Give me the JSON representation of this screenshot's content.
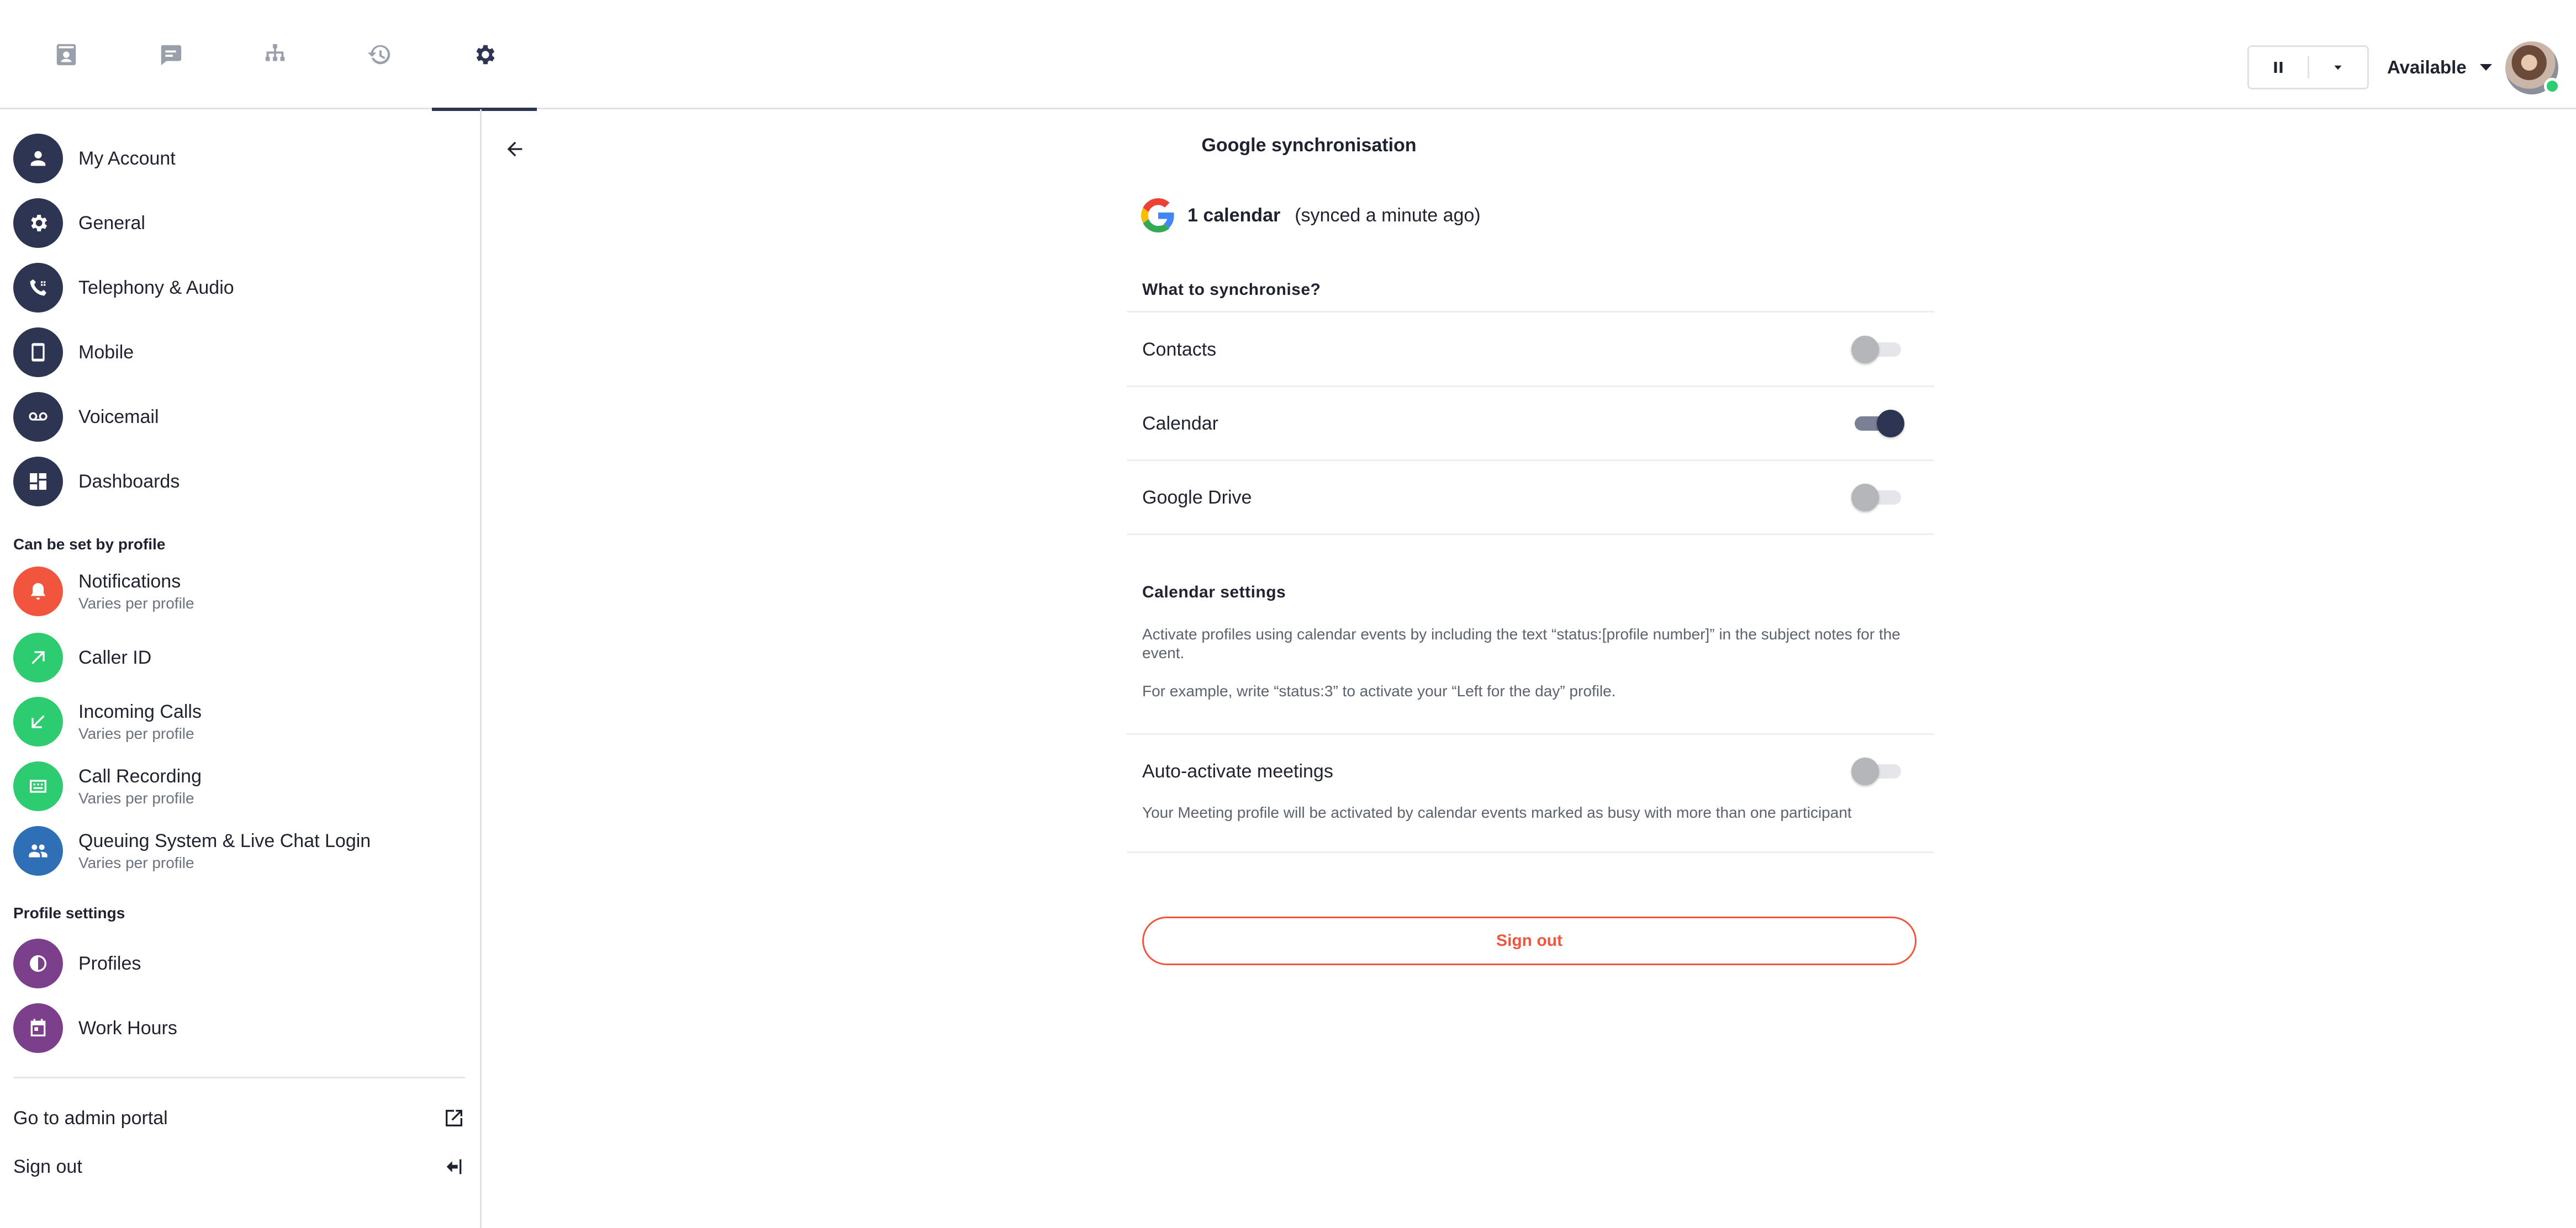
{
  "colors": {
    "navy": "#2d3552",
    "orange": "#f2553d",
    "green": "#2ecc71",
    "blue": "#2f6fb5",
    "purple": "#7b3f8c",
    "grey_icon": "#9aa0ab"
  },
  "topbar": {
    "tabs": [
      {
        "icon": "contacts-icon"
      },
      {
        "icon": "chat-icon"
      },
      {
        "icon": "org-chart-icon"
      },
      {
        "icon": "history-icon"
      },
      {
        "icon": "gear-icon",
        "active": true
      }
    ],
    "status_label": "Available"
  },
  "sidebar": {
    "items": [
      {
        "label": "My Account",
        "icon": "user-icon"
      },
      {
        "label": "General",
        "icon": "gear-icon"
      },
      {
        "label": "Telephony & Audio",
        "icon": "phone-icon"
      },
      {
        "label": "Mobile",
        "icon": "mobile-icon"
      },
      {
        "label": "Voicemail",
        "icon": "voicemail-icon"
      },
      {
        "label": "Dashboards",
        "icon": "dashboard-icon"
      }
    ],
    "section_profile": "Can be set by profile",
    "profile_items": [
      {
        "label": "Notifications",
        "sub": "Varies per profile",
        "icon": "bell-icon"
      },
      {
        "label": "Caller ID",
        "icon": "arrow-up-right-icon"
      },
      {
        "label": "Incoming Calls",
        "sub": "Varies per profile",
        "icon": "arrow-down-left-icon"
      },
      {
        "label": "Call Recording",
        "sub": "Varies per profile",
        "icon": "recording-icon"
      },
      {
        "label": "Queuing System & Live Chat Login",
        "sub": "Varies per profile",
        "icon": "group-icon"
      }
    ],
    "section_settings": "Profile settings",
    "settings_items": [
      {
        "label": "Profiles",
        "icon": "half-circle-icon"
      },
      {
        "label": "Work Hours",
        "icon": "calendar-icon"
      }
    ],
    "footer": {
      "admin_portal": "Go to admin portal",
      "sign_out": "Sign out"
    }
  },
  "main": {
    "title": "Google synchronisation",
    "sync_count": "1 calendar",
    "sync_status": "(synced a minute ago)",
    "what_heading": "What to synchronise?",
    "toggles": [
      {
        "label": "Contacts",
        "on": false
      },
      {
        "label": "Calendar",
        "on": true
      },
      {
        "label": "Google Drive",
        "on": false
      }
    ],
    "calendar_heading": "Calendar settings",
    "calendar_desc_1": "Activate profiles using calendar events by including the text “status:[profile number]” in the subject notes for the event.",
    "calendar_desc_2": "For example, write “status:3” to activate your “Left for the day” profile.",
    "auto_label": "Auto-activate meetings",
    "auto_on": false,
    "auto_desc": "Your Meeting profile will be activated by calendar events marked as busy with more than one participant",
    "sign_out_button": "Sign out"
  }
}
